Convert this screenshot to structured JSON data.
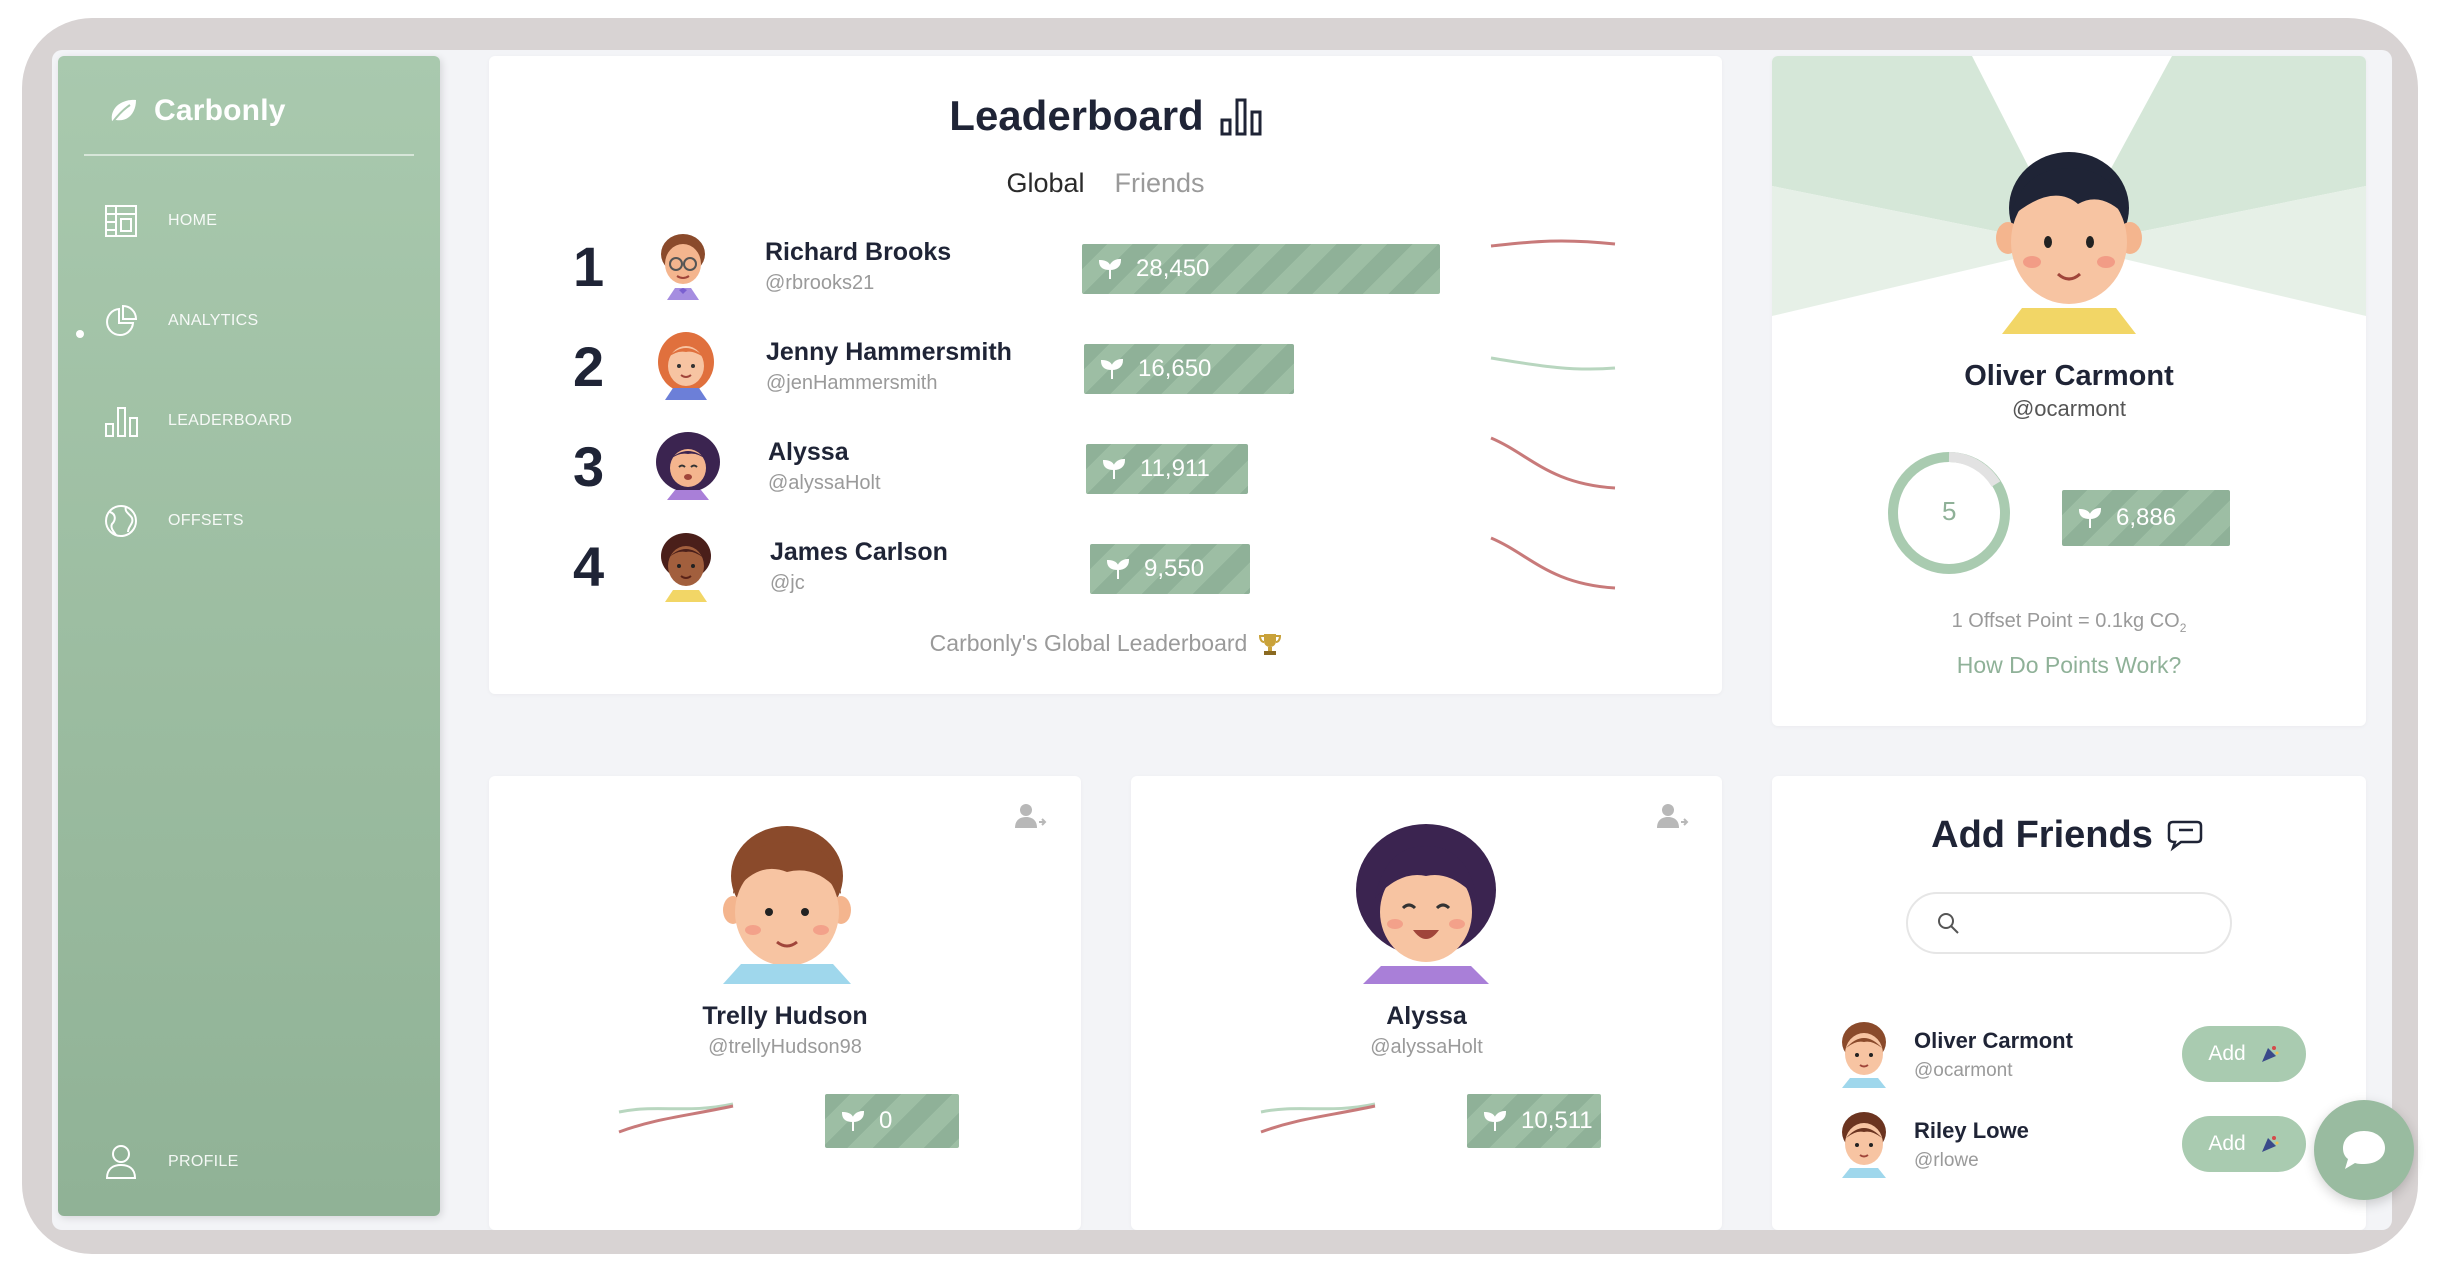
{
  "brand": {
    "name": "Carbonly"
  },
  "sidebar": {
    "items": [
      {
        "label": "HOME",
        "icon": "home-icon"
      },
      {
        "label": "ANALYTICS",
        "icon": "pie-chart-icon"
      },
      {
        "label": "LEADERBOARD",
        "icon": "bar-chart-icon",
        "active": true
      },
      {
        "label": "OFFSETS",
        "icon": "globe-icon"
      }
    ],
    "profile_label": "PROFILE"
  },
  "leaderboard": {
    "title": "Leaderboard",
    "tabs": {
      "global": "Global",
      "friends": "Friends"
    },
    "rows": [
      {
        "rank": "1",
        "name": "Richard Brooks",
        "handle": "@rbrooks21",
        "points": "28,450",
        "trend": "flat"
      },
      {
        "rank": "2",
        "name": "Jenny Hammersmith",
        "handle": "@jenHammersmith",
        "points": "16,650",
        "trend": "flat"
      },
      {
        "rank": "3",
        "name": "Alyssa",
        "handle": "@alyssaHolt",
        "points": "11,911",
        "trend": "down"
      },
      {
        "rank": "4",
        "name": "James Carlson",
        "handle": "@jc",
        "points": "9,550",
        "trend": "down"
      }
    ],
    "footer": "Carbonly's Global Leaderboard"
  },
  "profile": {
    "name": "Oliver Carmont",
    "handle": "@ocarmont",
    "ring_value": "5",
    "points": "6,886",
    "note": "1 Offset Point = 0.1kg CO",
    "note_sub": "2",
    "link": "How Do Points Work?"
  },
  "friends": [
    {
      "name": "Trelly Hudson",
      "handle": "@trellyHudson98",
      "points": "0"
    },
    {
      "name": "Alyssa",
      "handle": "@alyssaHolt",
      "points": "10,511"
    }
  ],
  "add_friends": {
    "title": "Add Friends",
    "search_placeholder": "",
    "suggestions": [
      {
        "name": "Oliver Carmont",
        "handle": "@ocarmont",
        "button": "Add"
      },
      {
        "name": "Riley Lowe",
        "handle": "@rlowe",
        "button": "Add"
      }
    ]
  },
  "colors": {
    "accent": "#9abb9f",
    "trend_up": "#b8d6bf",
    "trend_down": "#c87a7a"
  }
}
